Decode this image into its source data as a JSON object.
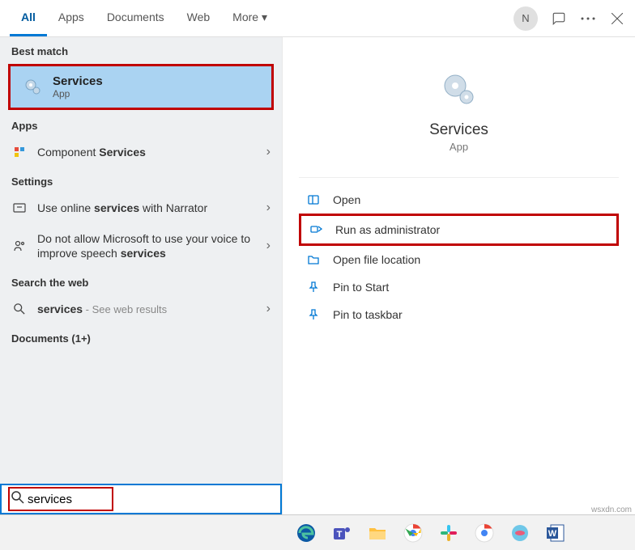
{
  "tabs": [
    "All",
    "Apps",
    "Documents",
    "Web",
    "More ▾"
  ],
  "active_tab": 0,
  "avatar_letter": "N",
  "sections": {
    "best_match": "Best match",
    "apps": "Apps",
    "settings": "Settings",
    "web": "Search the web",
    "documents": "Documents (1+)"
  },
  "best": {
    "title": "Services",
    "sub": "App"
  },
  "apps_item": {
    "prefix": "Component ",
    "bold": "Services"
  },
  "settings_items": [
    {
      "pre": "Use online ",
      "bold": "services",
      "post": " with Narrator"
    },
    {
      "pre": "Do not allow Microsoft to use your voice to improve speech ",
      "bold": "services",
      "post": ""
    }
  ],
  "web_item": {
    "bold": "services",
    "dim": " - See web results"
  },
  "detail": {
    "title": "Services",
    "sub": "App"
  },
  "actions": [
    "Open",
    "Run as administrator",
    "Open file location",
    "Pin to Start",
    "Pin to taskbar"
  ],
  "highlighted_action": 1,
  "search_value": "services",
  "watermark": "wsxdn.com"
}
